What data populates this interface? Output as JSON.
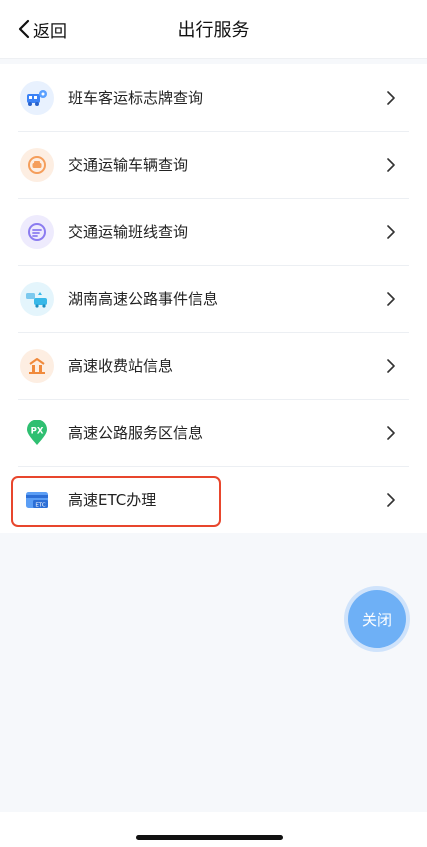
{
  "header": {
    "back_label": "返回",
    "title": "出行服务"
  },
  "menu": [
    {
      "label": "班车客运标志牌查询",
      "icon": "bus-sign-icon",
      "color": "#3b82f6"
    },
    {
      "label": "交通运输车辆查询",
      "icon": "vehicle-search-icon",
      "color": "#f59e5b"
    },
    {
      "label": "交通运输班线查询",
      "icon": "route-search-icon",
      "color": "#8b7cf0"
    },
    {
      "label": "湖南高速公路事件信息",
      "icon": "highway-event-icon",
      "color": "#38b8e8"
    },
    {
      "label": "高速收费站信息",
      "icon": "toll-station-icon",
      "color": "#f08a3c"
    },
    {
      "label": "高速公路服务区信息",
      "icon": "service-area-icon",
      "color": "#2fbf71",
      "badge": "PX"
    },
    {
      "label": "高速ETC办理",
      "icon": "etc-card-icon",
      "color": "#3b82f6",
      "badge": "ETC",
      "highlighted": true
    }
  ],
  "close_button": {
    "label": "关闭"
  },
  "colors": {
    "highlight_border": "#e8462d",
    "fab": "#6eb0f6"
  }
}
